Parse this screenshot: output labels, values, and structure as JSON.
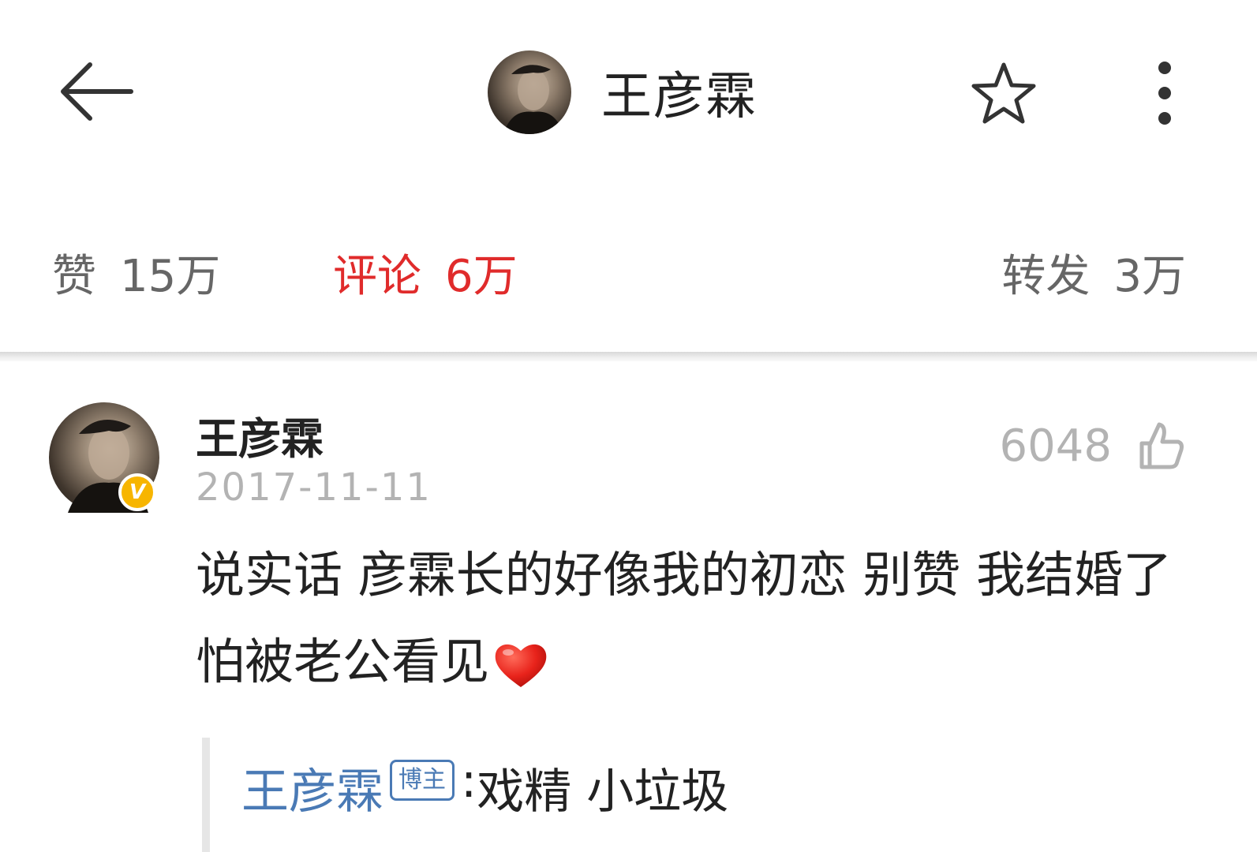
{
  "header": {
    "title": "王彦霖",
    "back_icon": "arrow-left-icon",
    "favorite_icon": "star-outline-icon",
    "more_icon": "more-vertical-icon"
  },
  "stats": {
    "like_label": "赞",
    "like_count": "15万",
    "comment_label": "评论",
    "comment_count": "6万",
    "repost_label": "转发",
    "repost_count": "3万",
    "active_color": "#e02b2b"
  },
  "comment": {
    "username": "王彦霖",
    "verified_badge": "V",
    "date": "2017-11-11",
    "like_count": "6048",
    "like_icon": "thumbs-up-outline-icon",
    "text": "说实话 彦霖长的好像我的初恋 别赞 我结婚了 怕被老公看见",
    "emoji": "red-heart-icon"
  },
  "reply": {
    "username": "王彦霖",
    "badge": "博主",
    "separator": ":",
    "text": "戏精 小垃圾",
    "link_color": "#4a7ab5"
  }
}
